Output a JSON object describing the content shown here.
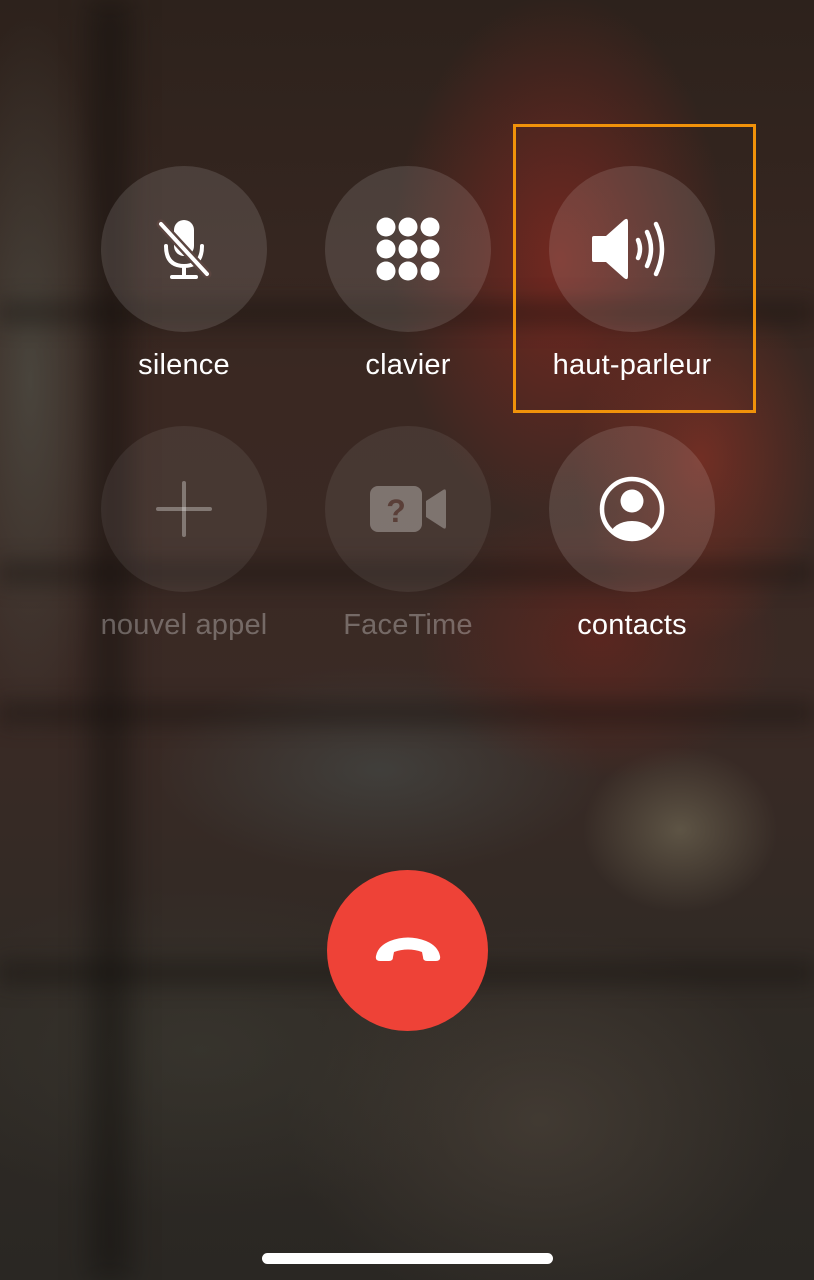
{
  "controls": {
    "mute": {
      "label": "silence",
      "icon": "microphone-muted-icon",
      "enabled": true
    },
    "keypad": {
      "label": "clavier",
      "icon": "keypad-icon",
      "enabled": true
    },
    "speaker": {
      "label": "haut-parleur",
      "icon": "speaker-icon",
      "enabled": true,
      "highlighted": true
    },
    "add_call": {
      "label": "nouvel appel",
      "icon": "plus-icon",
      "enabled": false
    },
    "facetime": {
      "label": "FaceTime",
      "icon": "facetime-unknown-icon",
      "enabled": false
    },
    "contacts": {
      "label": "contacts",
      "icon": "person-circle-icon",
      "enabled": true
    }
  },
  "end_call": {
    "icon": "phone-hangup-icon",
    "color": "#ee4237"
  },
  "colors": {
    "highlight_border": "#f0920a",
    "label_enabled": "#ffffff",
    "label_disabled": "rgba(255,255,255,0.30)"
  }
}
